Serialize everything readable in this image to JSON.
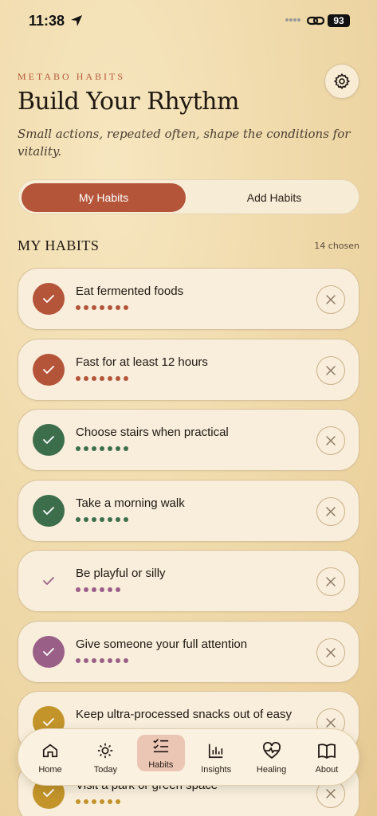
{
  "status": {
    "time": "11:38",
    "battery": "93"
  },
  "header": {
    "brand": "METABO HABITS",
    "title": "Build Your Rhythm",
    "subtitle": "Small actions, repeated often, shape the conditions for vitality."
  },
  "tabs": {
    "my_habits": "My Habits",
    "add_habits": "Add Habits"
  },
  "section": {
    "title": "MY HABITS",
    "chosen": "14 chosen"
  },
  "habits": [
    {
      "name": "Eat fermented foods",
      "color": "#b4553a",
      "checked": true,
      "dots": 7
    },
    {
      "name": "Fast for at least 12 hours",
      "color": "#b4553a",
      "checked": true,
      "dots": 7
    },
    {
      "name": "Choose stairs when practical",
      "color": "#3c6e4c",
      "checked": true,
      "dots": 7
    },
    {
      "name": "Take a morning walk",
      "color": "#3c6e4c",
      "checked": true,
      "dots": 7
    },
    {
      "name": "Be playful or silly",
      "color": "#9a5f86",
      "checked": false,
      "dots": 6
    },
    {
      "name": "Give someone your full attention",
      "color": "#9a5f86",
      "checked": true,
      "dots": 7
    },
    {
      "name": "Keep ultra-processed snacks out of easy",
      "color": "#c2942a",
      "checked": true,
      "dots": 7
    },
    {
      "name": "Visit a park or green space",
      "color": "#c2942a",
      "checked": true,
      "dots": 6
    }
  ],
  "nav": [
    {
      "label": "Home",
      "icon": "home-icon"
    },
    {
      "label": "Today",
      "icon": "sun-icon"
    },
    {
      "label": "Habits",
      "icon": "checklist-icon"
    },
    {
      "label": "Insights",
      "icon": "bar-chart-icon"
    },
    {
      "label": "Healing",
      "icon": "heart-pulse-icon"
    },
    {
      "label": "About",
      "icon": "book-icon"
    }
  ]
}
